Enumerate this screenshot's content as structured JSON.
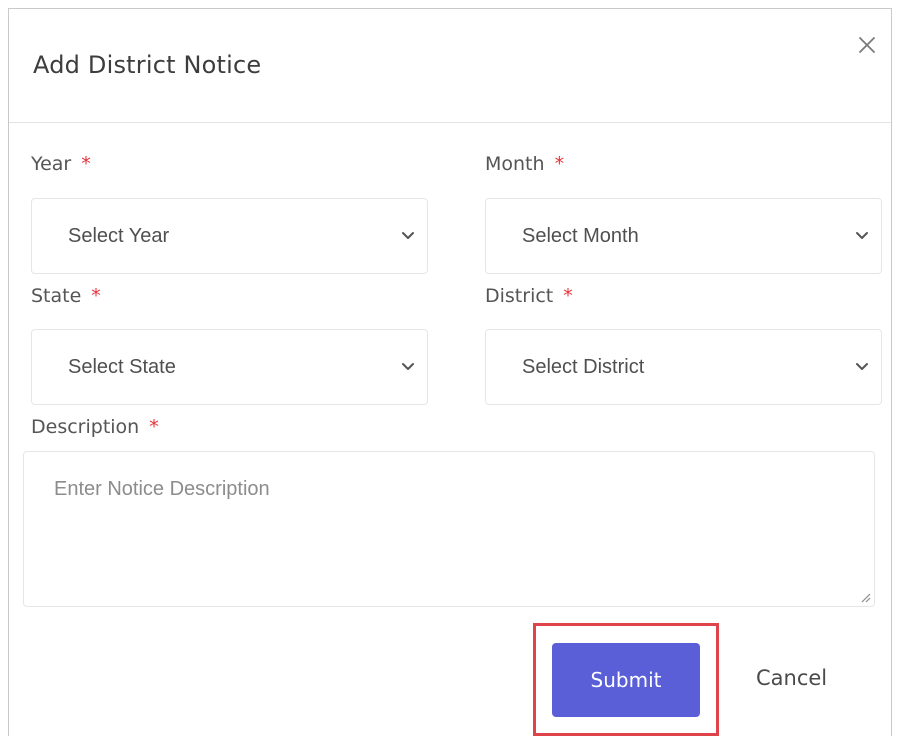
{
  "modal": {
    "title": "Add District Notice"
  },
  "form": {
    "required_mark": "*",
    "year": {
      "label": "Year",
      "value": "Select Year"
    },
    "month": {
      "label": "Month",
      "value": "Select Month"
    },
    "state": {
      "label": "State",
      "value": "Select State"
    },
    "district": {
      "label": "District",
      "value": "Select District"
    },
    "description": {
      "label": "Description",
      "placeholder": "Enter Notice Description"
    }
  },
  "actions": {
    "submit_label": "Submit",
    "cancel_label": "Cancel"
  },
  "colors": {
    "primary": "#5a5fd8",
    "required": "#e8323a",
    "highlight": "#e0444b"
  },
  "icons": {
    "close": "close-icon",
    "dropdown": "chevron-down-icon",
    "resize": "resize-handle-icon"
  }
}
